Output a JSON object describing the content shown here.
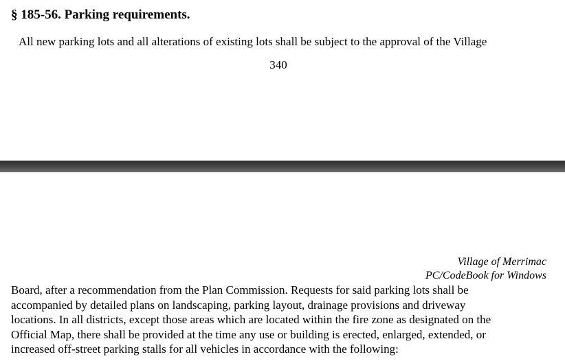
{
  "section": {
    "heading": "§ 185-56. Parking requirements.",
    "intro": "All new parking lots and all alterations of existing lots shall be subject to the approval of the Village"
  },
  "page_number": "340",
  "footer": {
    "line1": "Village of Merrimac",
    "line2": "PC/CodeBook for Windows"
  },
  "body_lines": [
    "Board, after a recommendation from the Plan Commission. Requests for said parking lots shall be",
    "accompanied by detailed plans on landscaping, parking layout, drainage provisions and driveway",
    "locations. In all districts, except those areas which are located within the fire zone as designated on the",
    "Official Map, there shall be provided at the time any use or building is erected, enlarged, extended, or",
    "increased off-street parking stalls for all vehicles in accordance with the following:"
  ]
}
